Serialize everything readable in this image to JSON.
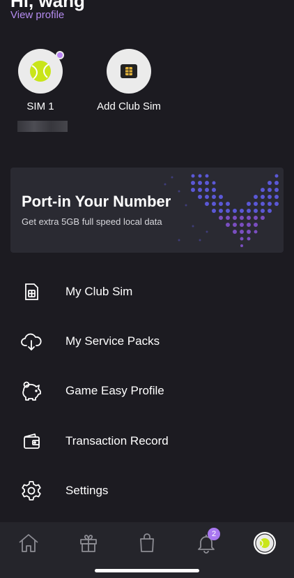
{
  "header": {
    "greeting": "Hi, wang",
    "view_profile": "View profile"
  },
  "sims": [
    {
      "label": "SIM 1",
      "icon": "tennis-ball-icon",
      "has_dot": true
    },
    {
      "label": "Add Club Sim",
      "icon": "sim-card-icon"
    }
  ],
  "banner": {
    "title": "Port-in Your Number",
    "subtitle": "Get extra 5GB full speed local data"
  },
  "menu": [
    {
      "label": "My Club Sim",
      "icon": "sim-card-outline-icon"
    },
    {
      "label": "My Service Packs",
      "icon": "cloud-download-icon"
    },
    {
      "label": "Game Easy Profile",
      "icon": "piggy-bank-icon"
    },
    {
      "label": "Transaction Record",
      "icon": "wallet-icon"
    },
    {
      "label": "Settings",
      "icon": "gear-icon"
    }
  ],
  "tabbar": {
    "items": [
      "home-icon",
      "gift-icon",
      "shopping-bag-icon",
      "bell-icon",
      "profile-avatar-icon"
    ],
    "notification_count": "2"
  },
  "colors": {
    "background": "#1c1b21",
    "accent": "#b58cf0",
    "banner": "#2a2a32",
    "tabbar": "#25252b"
  }
}
